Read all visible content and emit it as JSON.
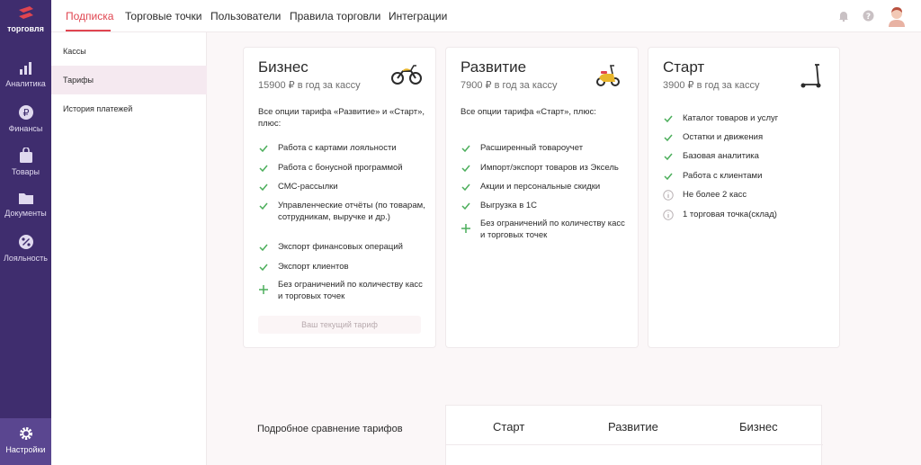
{
  "brand": {
    "logo_text": "торговля",
    "accent": "#e04550",
    "rail_bg": "#3f2d6e"
  },
  "rail": {
    "items": [
      {
        "label": "Аналитика",
        "icon": "bar-chart-icon"
      },
      {
        "label": "Финансы",
        "icon": "ruble-coin-icon"
      },
      {
        "label": "Товары",
        "icon": "shopping-bag-icon"
      },
      {
        "label": "Документы",
        "icon": "folder-icon"
      },
      {
        "label": "Лояльность",
        "icon": "percent-badge-icon"
      }
    ],
    "settings": {
      "label": "Настройки",
      "icon": "gear-icon"
    }
  },
  "topnav": {
    "tabs": [
      "Подписка",
      "Торговые точки",
      "Пользователи",
      "Правила торговли",
      "Интеграции"
    ],
    "active_tab": "Подписка"
  },
  "subnav": {
    "items": [
      "Кассы",
      "Тарифы",
      "История платежей"
    ],
    "active": "Тарифы"
  },
  "plans": [
    {
      "title": "Бизнес",
      "price": "15900 ₽ в год за кассу",
      "icon": "motorcycle-icon",
      "intro": "Все опции тарифа «Развитие» и «Старт», плюс:",
      "features": [
        {
          "text": "Работа с картами лояльности",
          "kind": "check"
        },
        {
          "text": "Работа с бонусной программой",
          "kind": "check"
        },
        {
          "text": "СМС-рассылки",
          "kind": "check"
        },
        {
          "text": "Управленческие отчёты (по товарам, сотрудникам, выручке и др.)",
          "kind": "check"
        },
        {
          "text": "Экспорт финансовых операций",
          "kind": "check"
        },
        {
          "text": "Экспорт клиентов",
          "kind": "check"
        },
        {
          "text": "Без ограничений по количеству касс и торговых точек",
          "kind": "plus"
        }
      ],
      "current_label": "Ваш текущий тариф"
    },
    {
      "title": "Развитие",
      "price": "7900 ₽ в год за кассу",
      "icon": "scooter-icon",
      "intro": "Все опции тарифа «Старт», плюс:",
      "features": [
        {
          "text": "Расширенный товароучет",
          "kind": "check"
        },
        {
          "text": "Импорт/экспорт товаров из Эксель",
          "kind": "check"
        },
        {
          "text": "Акции и персональные скидки",
          "kind": "check"
        },
        {
          "text": "Выгрузка в 1С",
          "kind": "check"
        },
        {
          "text": "Без ограничений по количеству касс и торговых точек",
          "kind": "plus"
        }
      ]
    },
    {
      "title": "Старт",
      "price": "3900 ₽ в год за кассу",
      "icon": "kick-scooter-icon",
      "features": [
        {
          "text": "Каталог товаров и услуг",
          "kind": "check"
        },
        {
          "text": "Остатки и движения",
          "kind": "check"
        },
        {
          "text": "Базовая аналитика",
          "kind": "check"
        },
        {
          "text": "Работа с клиентами",
          "kind": "check"
        },
        {
          "text": "Не более 2 касс",
          "kind": "info"
        },
        {
          "text": "1 торговая точка(склад)",
          "kind": "info"
        }
      ]
    }
  ],
  "comparison": {
    "title": "Подробное сравнение тарифов",
    "columns": [
      "Старт",
      "Развитие",
      "Бизнес"
    ]
  }
}
